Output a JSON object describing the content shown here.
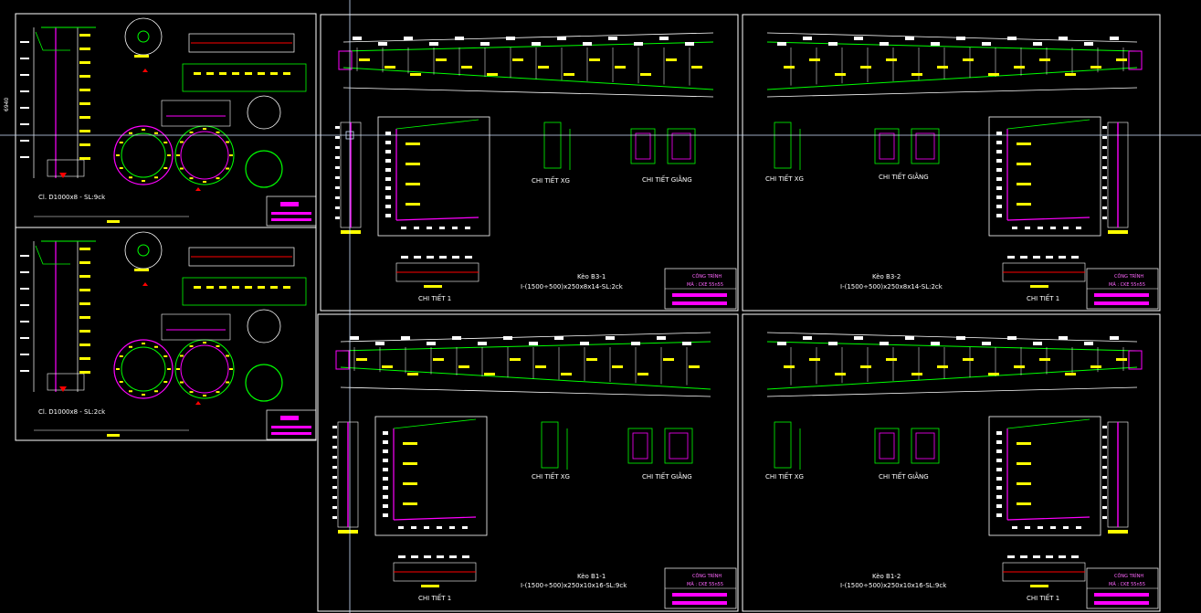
{
  "colors": {
    "background": "#000000",
    "frame": "#ffffff",
    "label": "#ffff00",
    "dimension": "#ffffff",
    "member": "#00ff00",
    "hatch": "#ff00ff",
    "section_red": "#ff0000",
    "crosshair": "#cfe3ff"
  },
  "dimension_side": "6940",
  "sheets": {
    "col1": {
      "caption": "Cl. D1000x8 - SL:9ck"
    },
    "col2": {
      "caption": "Cl. D1000x8 - SL:2ck"
    },
    "b3_1": {
      "name": "Kèo B3-1",
      "section": "I-(1500÷500)x250x8x14-SL:2ck",
      "detail1": "CHI TIẾT 1",
      "detail_xg": "CHI TIẾT XG",
      "detail_giang": "CHI TIẾT GIẰNG",
      "title_block": {
        "project": "CÔNG TRÌNH",
        "code": "MÃ : CKE 55n55"
      }
    },
    "b3_2": {
      "name": "Kèo B3-2",
      "section": "I-(1500÷500)x250x8x14-SL:2ck",
      "detail1": "CHI TIẾT 1",
      "detail_xg": "CHI TIẾT XG",
      "detail_giang": "CHI TIẾT GIẰNG",
      "title_block": {
        "project": "CÔNG TRÌNH",
        "code": "MÃ : CKE 55n55"
      }
    },
    "b1_1": {
      "name": "Kèo B1-1",
      "section": "I-(1500÷500)x250x10x16-SL:9ck",
      "detail1": "CHI TIẾT 1",
      "detail_xg": "CHI TIẾT XG",
      "detail_giang": "CHI TIẾT GIẰNG",
      "title_block": {
        "project": "CÔNG TRÌNH",
        "code": "MÃ : CKE 55n55"
      }
    },
    "b1_2": {
      "name": "Kèo B1-2",
      "section": "I-(1500÷500)x250x10x16-SL:9ck",
      "detail1": "CHI TIẾT 1",
      "detail_xg": "CHI TIẾT XG",
      "detail_giang": "CHI TIẾT GIẰNG",
      "title_block": {
        "project": "CÔNG TRÌNH",
        "code": "MÃ : CKE 55n55"
      }
    }
  }
}
